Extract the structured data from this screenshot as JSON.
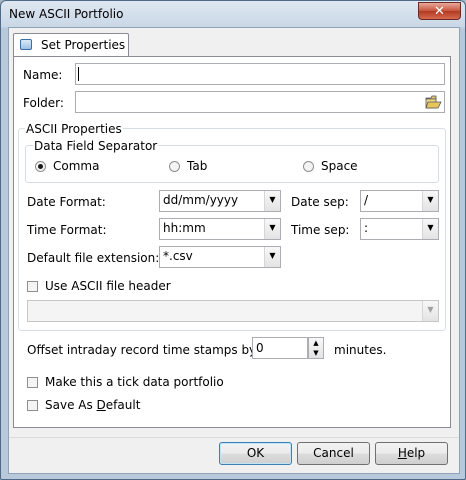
{
  "window": {
    "title": "New ASCII Portfolio",
    "close_glyph": "✕"
  },
  "tab": {
    "label": "Set Properties",
    "icon": "window-icon"
  },
  "name_field": {
    "label": "Name:",
    "value": ""
  },
  "folder_field": {
    "label": "Folder:",
    "value": "",
    "browse_icon": "folder-open-icon"
  },
  "ascii_properties": {
    "group_label": "ASCII Properties",
    "separator": {
      "group_label": "Data Field Separator",
      "options": [
        {
          "label": "Comma",
          "selected": true
        },
        {
          "label": "Tab",
          "selected": false
        },
        {
          "label": "Space",
          "selected": false
        }
      ]
    },
    "date_format": {
      "label": "Date Format:",
      "value": "dd/mm/yyyy"
    },
    "date_sep": {
      "label": "Date sep:",
      "value": "/"
    },
    "time_format": {
      "label": "Time Format:",
      "value": "hh:mm"
    },
    "time_sep": {
      "label": "Time sep:",
      "value": ":"
    },
    "file_ext": {
      "label": "Default file extension:",
      "value": "*.csv"
    },
    "use_header": {
      "label": "Use ASCII file header",
      "checked": false
    },
    "header_combo": {
      "value": ""
    }
  },
  "offset": {
    "label_before": "Offset intraday record time stamps by",
    "value": "0",
    "label_after": "minutes."
  },
  "tick_portfolio": {
    "label": "Make this a tick data portfolio",
    "checked": false
  },
  "save_default": {
    "label_prefix": "Save As ",
    "label_underlined": "D",
    "label_suffix": "efault",
    "checked": false
  },
  "buttons": {
    "ok": "OK",
    "cancel": "Cancel",
    "help_underlined": "H",
    "help_rest": "elp"
  },
  "arrow_glyph": "▼"
}
